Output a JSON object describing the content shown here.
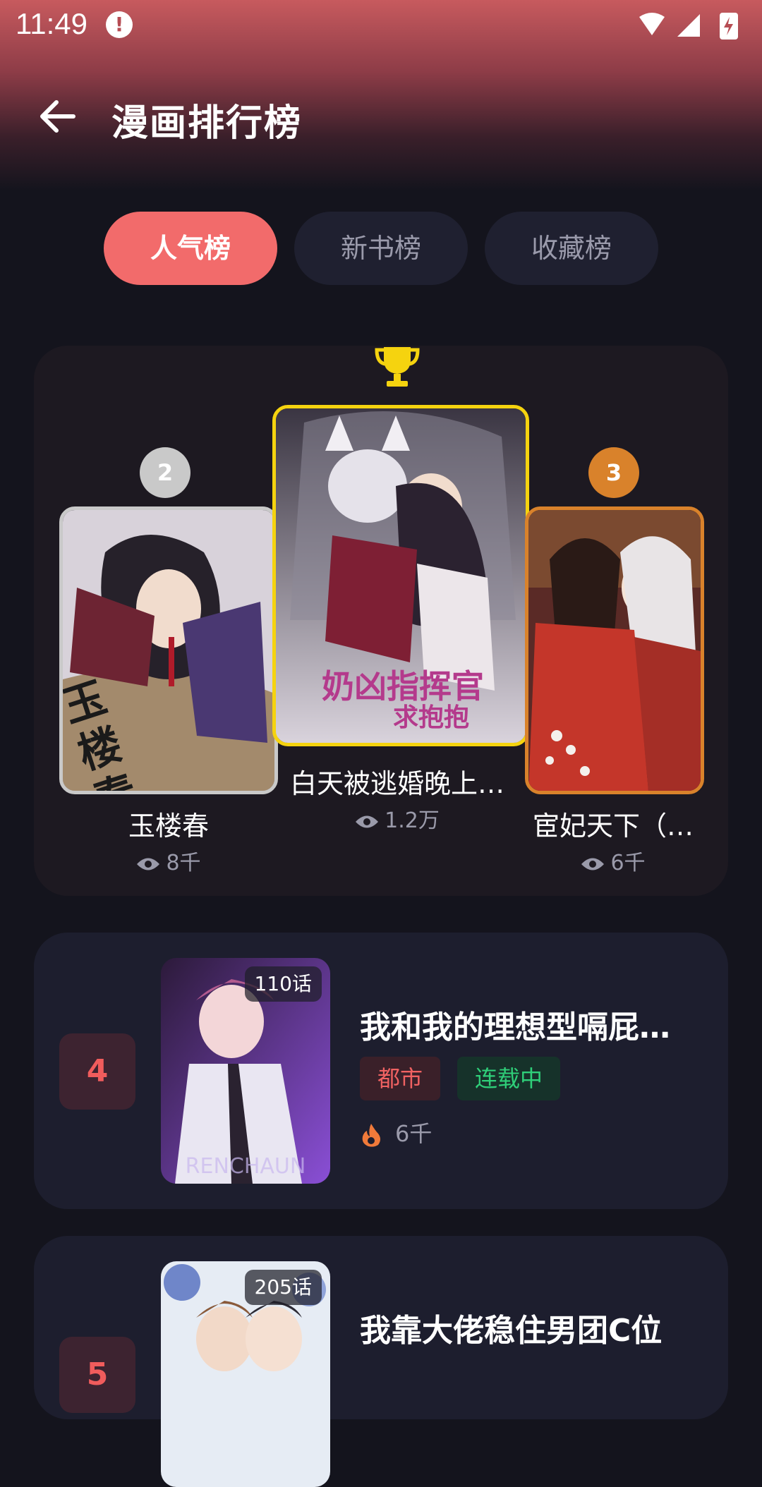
{
  "status_bar": {
    "time": "11:49",
    "alert_glyph": "!"
  },
  "header": {
    "title": "漫画排行榜",
    "back_icon": "arrow-left-icon"
  },
  "tabs": [
    {
      "label": "人气榜",
      "active": true
    },
    {
      "label": "新书榜",
      "active": false
    },
    {
      "label": "收藏榜",
      "active": false
    }
  ],
  "podium": {
    "first": {
      "title": "白天被逃婚晚上…",
      "views": "1.2万"
    },
    "second": {
      "rank": "2",
      "title": "玉楼春",
      "views": "8千",
      "cover_text": "玉楼春"
    },
    "third": {
      "rank": "3",
      "title": "宦妃天下（…",
      "views": "6千"
    }
  },
  "list": [
    {
      "rank": "4",
      "episodes": "110话",
      "title": "我和我的理想型嗝屁…",
      "genre": "都市",
      "status": "连载中",
      "popularity": "6千"
    },
    {
      "rank": "5",
      "episodes": "205话",
      "title": "我靠大佬稳住男团C位"
    }
  ],
  "colors": {
    "accent": "#f26b6b",
    "gold": "#f5d30f",
    "silver": "#c9c9c9",
    "bronze": "#d9822b",
    "background": "#14141d"
  }
}
